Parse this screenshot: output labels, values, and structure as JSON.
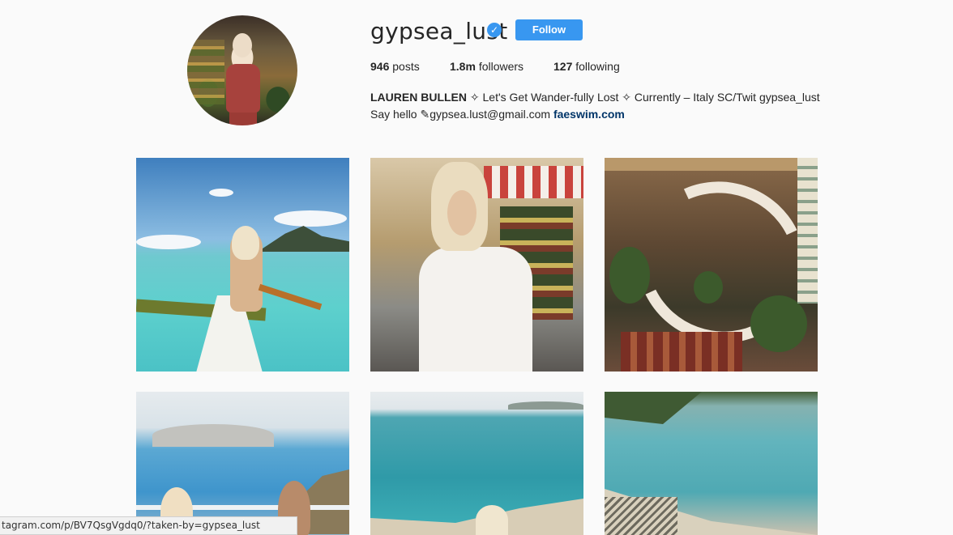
{
  "profile": {
    "username": "gypsea_lust",
    "verified_icon": "verified-badge-icon",
    "follow_label": "Follow",
    "stats": {
      "posts_count": "946",
      "posts_label": "posts",
      "followers_count": "1.8m",
      "followers_label": "followers",
      "following_count": "127",
      "following_label": "following"
    },
    "bio": {
      "name": "LAUREN BULLEN",
      "line1_rest": " ✧ Let's Get Wander-fully Lost ✧ Currently – Italy SC/Twit gypsea_lust",
      "line2_text": "Say hello ✎gypsea.lust@gmail.com ",
      "link": "faeswim.com"
    }
  },
  "posts": [
    {
      "name": "post-tile-1"
    },
    {
      "name": "post-tile-2"
    },
    {
      "name": "post-tile-3"
    },
    {
      "name": "post-tile-4"
    },
    {
      "name": "post-tile-5"
    },
    {
      "name": "post-tile-6"
    }
  ],
  "status_bar": {
    "url": "tagram.com/p/BV7QsgVgdq0/?taken-by=gypsea_lust"
  },
  "colors": {
    "accent": "#3897f0",
    "link": "#003569",
    "background": "#fafafa"
  }
}
